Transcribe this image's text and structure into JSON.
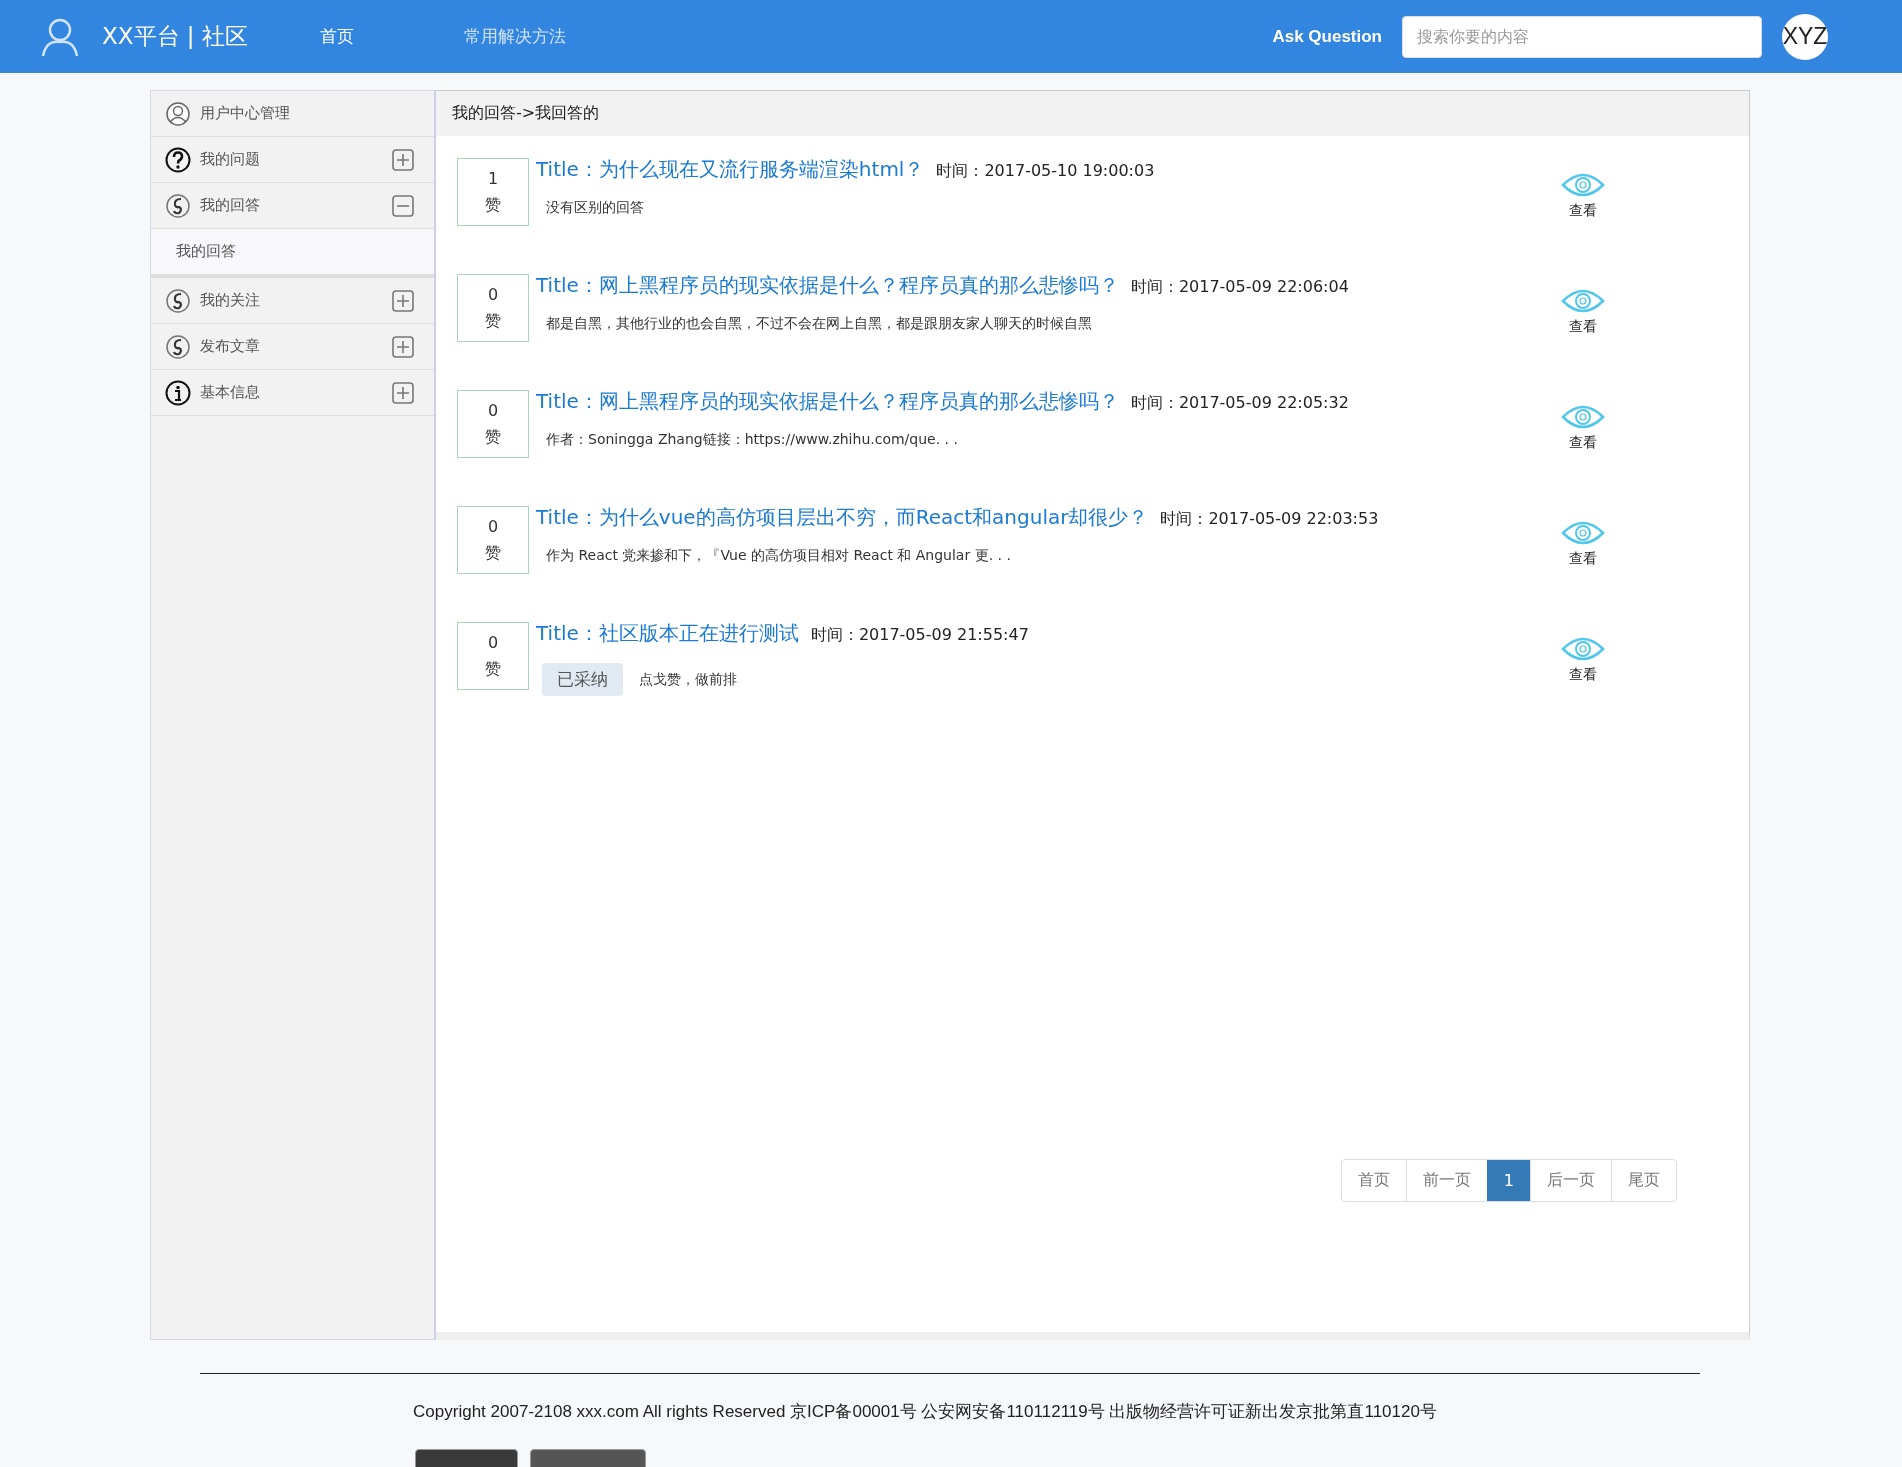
{
  "header": {
    "brand": "XX平台 | 社区",
    "nav": [
      {
        "label": "首页",
        "selected": true
      },
      {
        "label": "常用解决方法",
        "selected": false
      }
    ],
    "ask": "Ask Question",
    "search": {
      "placeholder": "搜索你要的内容"
    },
    "avatar": "XYZ"
  },
  "sidebar": {
    "title": "用户中心管理",
    "groups": [
      {
        "label": "我的问题",
        "expanded": false
      },
      {
        "label": "我的回答",
        "expanded": true,
        "children": [
          {
            "label": "我的回答",
            "selected": true
          }
        ]
      },
      {
        "label": "我的关注",
        "expanded": false
      },
      {
        "label": "发布文章",
        "expanded": false
      },
      {
        "label": "基本信息",
        "expanded": false
      }
    ]
  },
  "breadcrumb": "我的回答->我回答的",
  "answers": [
    {
      "votes": "1",
      "vote_unit": "赞",
      "title": "Title：为什么现在又流行服务端渲染html？",
      "time": "时间：2017-05-10 19:00:03",
      "excerpt": "没有区别的回答",
      "view": "查看"
    },
    {
      "votes": "0",
      "vote_unit": "赞",
      "title": "Title：网上黑程序员的现实依据是什么？程序员真的那么悲惨吗？",
      "time": "时间：2017-05-09 22:06:04",
      "excerpt": "都是自黑，其他行业的也会自黑，不过不会在网上自黑，都是跟朋友家人聊天的时候自黑",
      "view": "查看"
    },
    {
      "votes": "0",
      "vote_unit": "赞",
      "title": "Title：网上黑程序员的现实依据是什么？程序员真的那么悲惨吗？",
      "time": "时间：2017-05-09 22:05:32",
      "excerpt": "作者：Soningga Zhang链接：https://www.zhihu.com/que. . .",
      "view": "查看"
    },
    {
      "votes": "0",
      "vote_unit": "赞",
      "title": "Title：为什么vue的高仿项目层出不穷，而React和angular却很少？",
      "time": "时间：2017-05-09 22:03:53",
      "excerpt": "作为 React 党来掺和下，『Vue 的高仿项目相对 React 和 Angular 更. . .",
      "view": "查看"
    },
    {
      "votes": "0",
      "vote_unit": "赞",
      "title": "Title：社区版本正在进行测试",
      "time": "时间：2017-05-09 21:55:47",
      "badge": "已采纳",
      "excerpt": "点戈赞，做前排",
      "view": "查看"
    }
  ],
  "pagination": [
    {
      "label": "首页",
      "selected": false
    },
    {
      "label": "前一页",
      "selected": false
    },
    {
      "label": "1",
      "selected": true
    },
    {
      "label": "后一页",
      "selected": false
    },
    {
      "label": "尾页",
      "selected": false
    }
  ],
  "footer": {
    "copyright": "Copyright 2007-2108 xxx.com All rights Reserved 京ICP备00001号 公安网安备110112119号 出版物经营许可证新出发京批第直110120号"
  }
}
